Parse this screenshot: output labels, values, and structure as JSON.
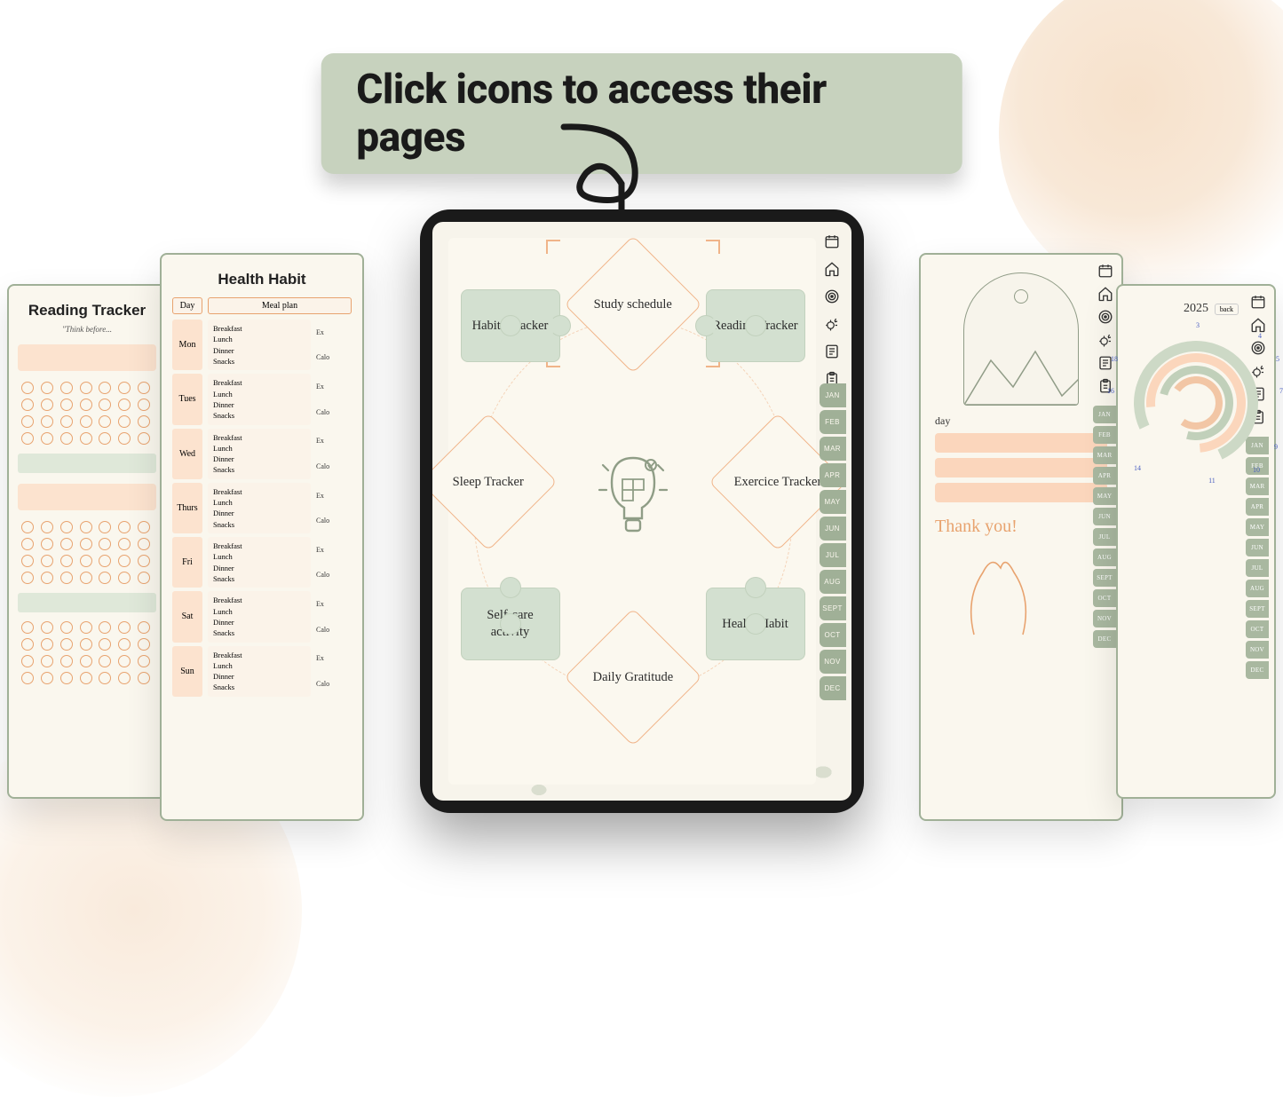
{
  "headline": "Click icons to access their pages",
  "hub_nodes": {
    "study": "Study schedule",
    "habits": "Habits Tracker",
    "reading": "Reading Tracker",
    "sleep": "Sleep Tracker",
    "exercice": "Exercice Tracker",
    "selfcare": "Self-care activity",
    "gratitude": "Daily Gratitude",
    "health": "Health Habit"
  },
  "months": [
    "JAN",
    "FEB",
    "MAR",
    "APR",
    "MAY",
    "JUN",
    "JUL",
    "AUG",
    "SEPT",
    "OCT",
    "NOV",
    "DEC"
  ],
  "sidebar_icons": [
    "calendar",
    "home",
    "target",
    "sparkle",
    "notes",
    "clipboard"
  ],
  "card_reading": {
    "title": "Reading Tracker",
    "subquote": "\"Think before..."
  },
  "card_health": {
    "title": "Health Habit",
    "head_day": "Day",
    "head_meal": "Meal plan",
    "days": [
      "Mon",
      "Tues",
      "Wed",
      "Thurs",
      "Fri",
      "Sat",
      "Sun"
    ],
    "meals": [
      "Breakfast",
      "Lunch",
      "Dinner",
      "Snacks"
    ],
    "side": [
      "Ex",
      "Calo"
    ]
  },
  "card_today": {
    "label": "day",
    "thanks": "Thank you!"
  },
  "card_year": {
    "year": "2025",
    "back": "back"
  }
}
